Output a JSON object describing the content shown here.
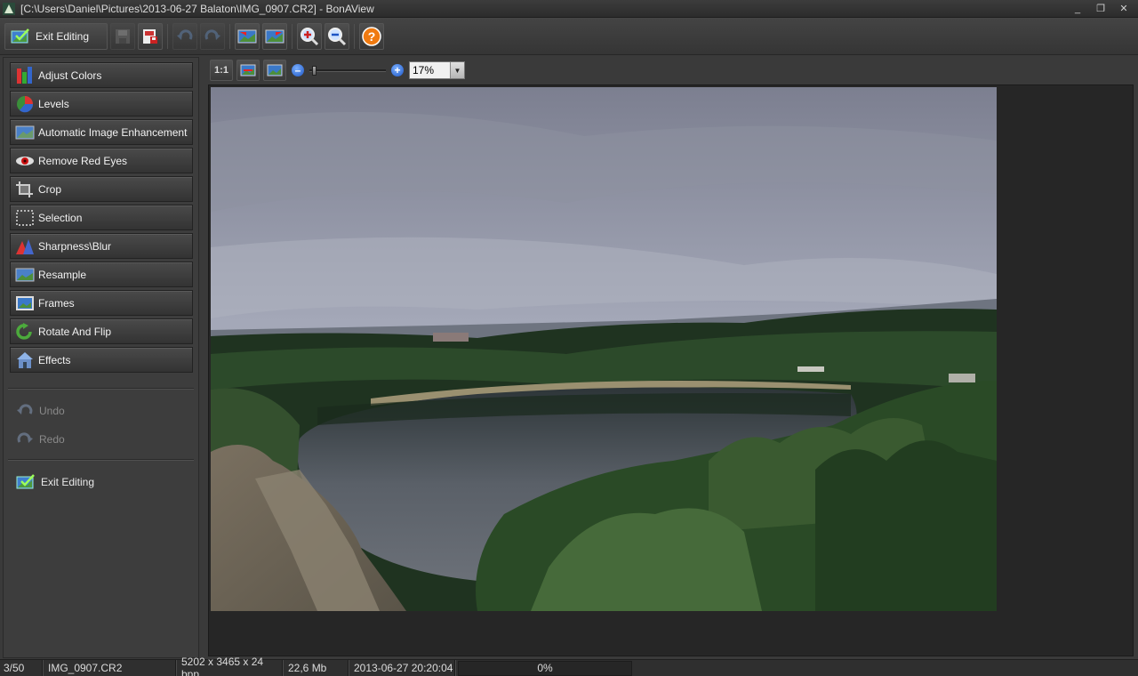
{
  "window": {
    "title": "[C:\\Users\\Daniel\\Pictures\\2013-06-27 Balaton\\IMG_0907.CR2] - BonAView",
    "minimize_label": "_",
    "restore_label": "❐",
    "close_label": "✕"
  },
  "toolbar": {
    "exit_label": "Exit Editing"
  },
  "tools": [
    {
      "label": "Adjust Colors",
      "icon": "adjust-colors-icon"
    },
    {
      "label": "Levels",
      "icon": "levels-icon"
    },
    {
      "label": "Automatic Image Enhancement",
      "icon": "auto-enhance-icon"
    },
    {
      "label": "Remove Red Eyes",
      "icon": "red-eye-icon"
    },
    {
      "label": "Crop",
      "icon": "crop-icon"
    },
    {
      "label": "Selection",
      "icon": "selection-icon"
    },
    {
      "label": "Sharpness\\Blur",
      "icon": "sharpness-icon"
    },
    {
      "label": "Resample",
      "icon": "resample-icon"
    },
    {
      "label": "Frames",
      "icon": "frames-icon"
    },
    {
      "label": "Rotate And Flip",
      "icon": "rotate-icon"
    },
    {
      "label": "Effects",
      "icon": "effects-icon"
    }
  ],
  "history": {
    "undo_label": "Undo",
    "redo_label": "Redo",
    "exit_label": "Exit Editing"
  },
  "view": {
    "actual_size_label": "1:1",
    "zoom_value": "17%",
    "zoom_level": 0.17
  },
  "status": {
    "position": "3/50",
    "filename": "IMG_0907.CR2",
    "dimensions": "5202 x 3465 x 24 bpp",
    "filesize": "22,6 Mb",
    "datetime": "2013-06-27 20:20:04",
    "progress": "0%"
  },
  "colors": {
    "help_orange": "#f07a10",
    "zoom_blue": "#1d55c4"
  }
}
